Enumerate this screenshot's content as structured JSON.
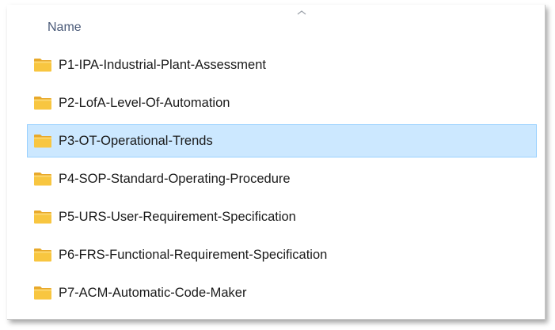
{
  "header": {
    "name_label": "Name",
    "sort_icon": "chevron-up-icon"
  },
  "folder_icon": "folder-icon",
  "colors": {
    "selection_bg": "#cce8ff",
    "selection_border": "#99d1ff",
    "folder_yellow": "#f8c640",
    "header_text": "#4a5a78"
  },
  "items": [
    {
      "label": "P1-IPA-Industrial-Plant-Assessment",
      "selected": false
    },
    {
      "label": "P2-LofA-Level-Of-Automation",
      "selected": false
    },
    {
      "label": "P3-OT-Operational-Trends",
      "selected": true
    },
    {
      "label": "P4-SOP-Standard-Operating-Procedure",
      "selected": false
    },
    {
      "label": "P5-URS-User-Requirement-Specification",
      "selected": false
    },
    {
      "label": "P6-FRS-Functional-Requirement-Specification",
      "selected": false
    },
    {
      "label": "P7-ACM-Automatic-Code-Maker",
      "selected": false
    }
  ]
}
